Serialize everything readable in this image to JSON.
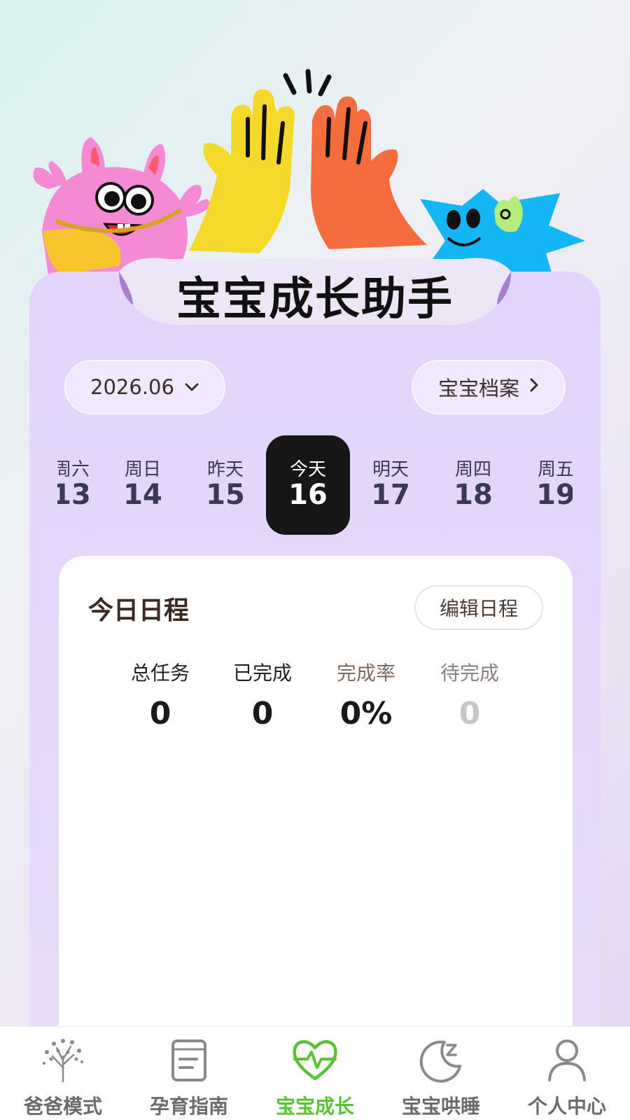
{
  "app": {
    "title": "宝宝成长助手"
  },
  "header": {
    "month_selector": "2026.06",
    "profile_link": "宝宝档案"
  },
  "week": [
    {
      "label": "周六",
      "num": "13"
    },
    {
      "label": "周日",
      "num": "14"
    },
    {
      "label": "昨天",
      "num": "15"
    },
    {
      "label": "今天",
      "num": "16",
      "selected": true
    },
    {
      "label": "明天",
      "num": "17"
    },
    {
      "label": "周四",
      "num": "18"
    },
    {
      "label": "周五",
      "num": "19"
    }
  ],
  "schedule": {
    "title": "今日日程",
    "edit_button": "编辑日程",
    "stats": [
      {
        "label": "总任务",
        "value": "0"
      },
      {
        "label": "已完成",
        "value": "0"
      },
      {
        "label": "完成率",
        "value": "0%"
      },
      {
        "label": "待完成",
        "value": "0"
      }
    ]
  },
  "tabbar": {
    "items": [
      {
        "label": "爸爸模式",
        "icon": "tree-icon"
      },
      {
        "label": "孕育指南",
        "icon": "notebook-icon"
      },
      {
        "label": "宝宝成长",
        "icon": "heart-pulse-icon",
        "active": true
      },
      {
        "label": "宝宝哄睡",
        "icon": "moon-sleep-icon"
      },
      {
        "label": "个人中心",
        "icon": "user-icon"
      }
    ]
  },
  "colors": {
    "accent_green": "#5bc236",
    "card_lavender": "#e2d4fb",
    "selected_day": "#161616"
  }
}
